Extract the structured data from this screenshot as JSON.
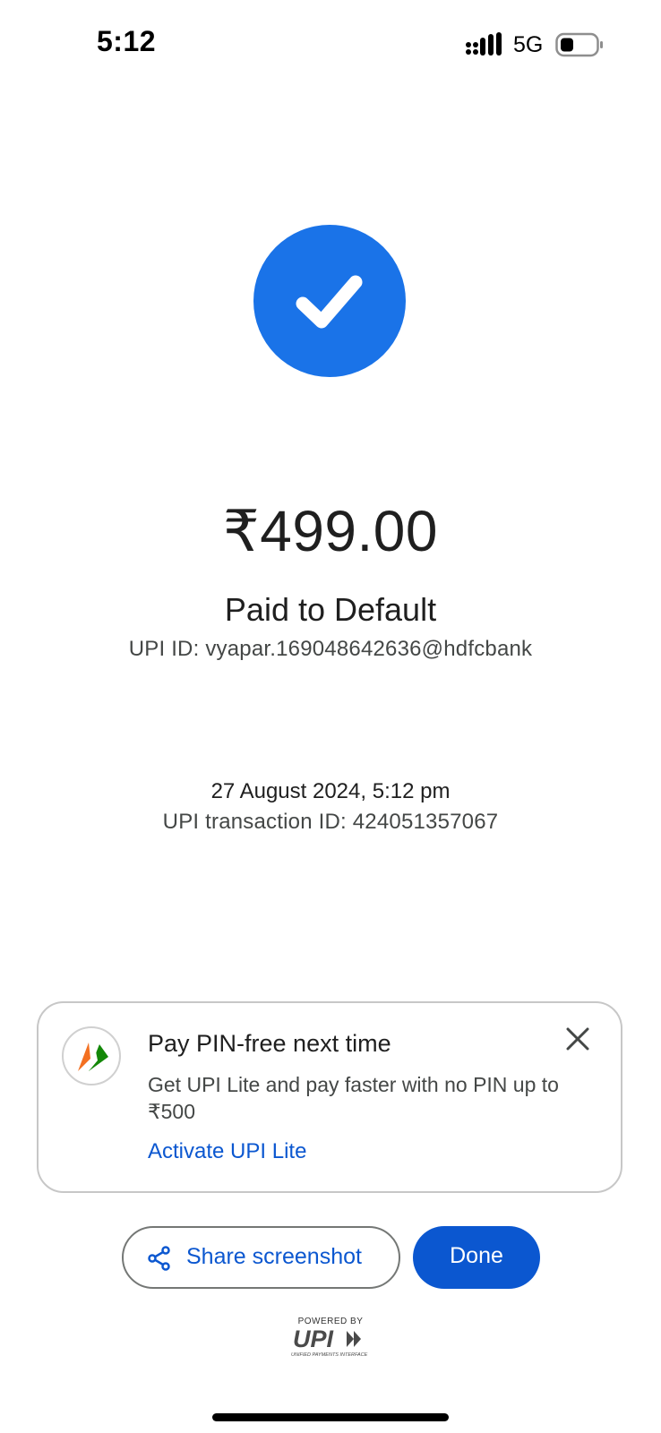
{
  "status_bar": {
    "time": "5:12",
    "network": "5G"
  },
  "payment": {
    "amount": "₹499.00",
    "paid_to": "Paid to Default",
    "upi_id": "UPI ID: vyapar.169048642636@hdfcbank",
    "date_time": "27 August 2024, 5:12 pm",
    "transaction_id": "UPI transaction ID: 424051357067"
  },
  "promo": {
    "title": "Pay PIN-free next time",
    "description": "Get UPI Lite and pay faster with no PIN up to ₹500",
    "link": "Activate UPI Lite"
  },
  "actions": {
    "share_label": "Share screenshot",
    "done_label": "Done"
  },
  "branding": {
    "powered_by": "POWERED BY",
    "upi_subtitle": "UNIFIED PAYMENTS INTERFACE"
  },
  "colors": {
    "accent": "#1a73e8",
    "button_primary": "#0b57d0"
  }
}
